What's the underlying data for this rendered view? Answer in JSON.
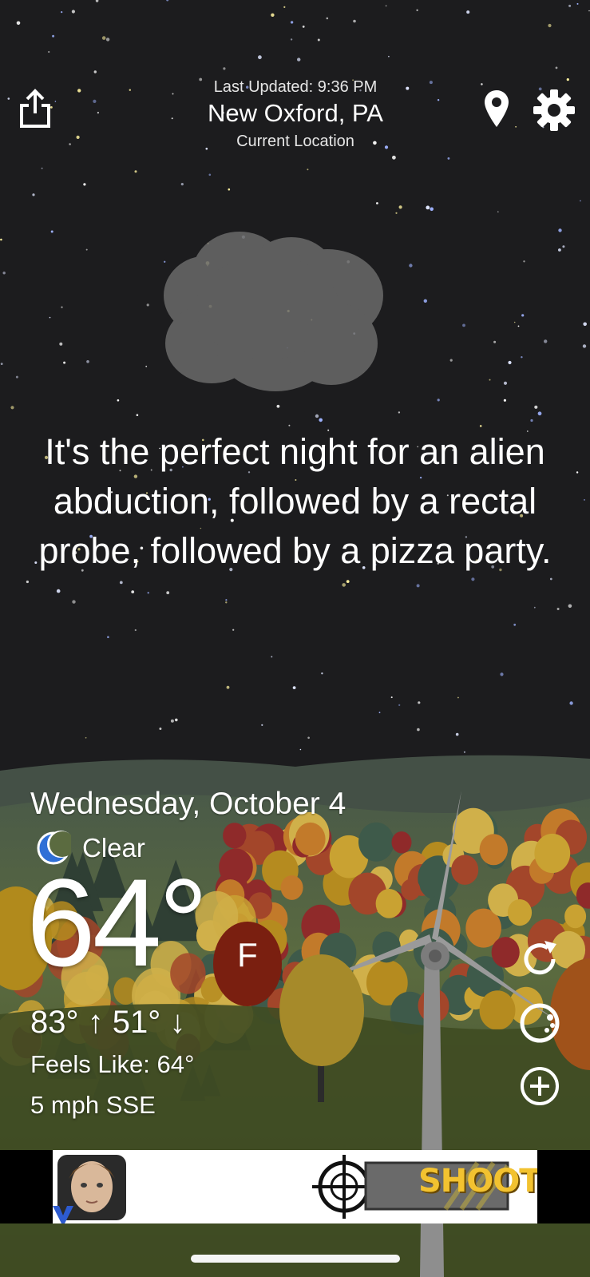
{
  "header": {
    "last_updated": "Last Updated: 9:36 PM",
    "city": "New Oxford, PA",
    "location_label": "Current Location"
  },
  "icons": {
    "share": "share-icon",
    "location": "location-pin-icon",
    "settings": "gear-icon",
    "refresh": "refresh-icon",
    "radar": "radar-icon",
    "add": "add-circle-icon",
    "condition": "moon-icon"
  },
  "forecast": {
    "quote": "It's the perfect night for an alien abduction, followed by a rectal probe, followed by a pizza party.",
    "date": "Wednesday, October 4",
    "condition": "Clear",
    "temperature": "64°",
    "unit": "F",
    "high": "83°",
    "low": "51°",
    "hilo_text": "83° ↑  51° ↓",
    "feels_like": "Feels Like: 64°",
    "wind": "5 mph SSE"
  },
  "ad": {
    "cta": "SHOOT"
  },
  "colors": {
    "sky": "#1c1c1e",
    "hills": "#5a6a3e",
    "unit_badge": "#7a1f10",
    "moon_icon": "#2f6fd6",
    "ad_text": "#f2c230"
  }
}
